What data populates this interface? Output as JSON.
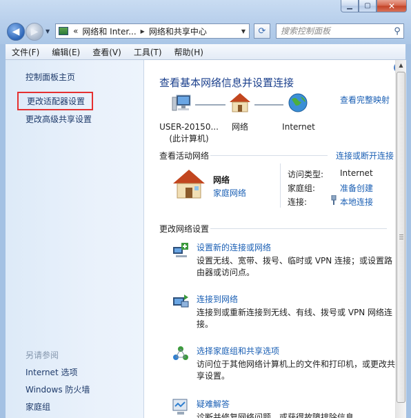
{
  "window": {
    "caption_buttons": [
      "minimize",
      "maximize",
      "close"
    ],
    "accent_color": "#1a5fb4"
  },
  "address_bar": {
    "overflow": "«",
    "crumbs": [
      "网络和 Inter...",
      "网络和共享中心"
    ],
    "search_placeholder": "搜索控制面板"
  },
  "menu": [
    "文件(F)",
    "编辑(E)",
    "查看(V)",
    "工具(T)",
    "帮助(H)"
  ],
  "sidebar": {
    "links": [
      "控制面板主页",
      "更改适配器设置",
      "更改高级共享设置"
    ],
    "see_also_heading": "另请参阅",
    "see_also": [
      "Internet 选项",
      "Windows 防火墙",
      "家庭组"
    ]
  },
  "main": {
    "title": "查看基本网络信息并设置连接",
    "view_full_map": "查看完整映射",
    "map_nodes": [
      {
        "line1": "USER-20150...",
        "line2": "(此计算机)",
        "icon": "computer-icon"
      },
      {
        "line1": "网络",
        "line2": "",
        "icon": "house-icon"
      },
      {
        "line1": "Internet",
        "line2": "",
        "icon": "globe-icon"
      }
    ],
    "active_networks_title": "查看活动网络",
    "connect_disconnect": "连接或断开连接",
    "network": {
      "name": "网络",
      "type": "家庭网络",
      "access_type_label": "访问类型:",
      "access_type_value": "Internet",
      "homegroup_label": "家庭组:",
      "homegroup_value": "准备创建",
      "connections_label": "连接:",
      "connections_value": "本地连接"
    },
    "change_settings_title": "更改网络设置",
    "tasks": [
      {
        "link": "设置新的连接或网络",
        "desc": "设置无线、宽带、拨号、临时或 VPN 连接；或设置路由器或访问点。",
        "icon": "new-connection-icon"
      },
      {
        "link": "连接到网络",
        "desc": "连接到或重新连接到无线、有线、拨号或 VPN 网络连接。",
        "icon": "connect-network-icon"
      },
      {
        "link": "选择家庭组和共享选项",
        "desc": "访问位于其他网络计算机上的文件和打印机，或更改共享设置。",
        "icon": "homegroup-icon"
      },
      {
        "link": "疑难解答",
        "desc": "诊断并修复网络问题，或获得故障排除信息。",
        "icon": "troubleshoot-icon"
      }
    ]
  }
}
